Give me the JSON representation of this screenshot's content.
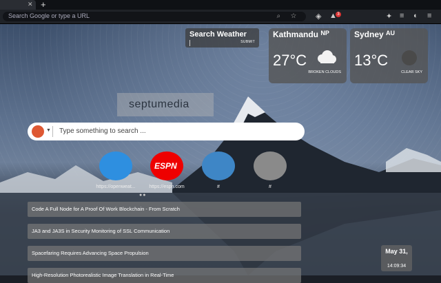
{
  "browser": {
    "address_placeholder": "Search Google or type a URL",
    "notification_count": "3"
  },
  "weather_search": {
    "title": "Search Weather",
    "submit": "SUBMIT"
  },
  "weather_cards": [
    {
      "city": "Kathmandu",
      "country": "NP",
      "temp": "27°C",
      "condition": "BROKEN CLOUDS",
      "icon": "cloud-icon"
    },
    {
      "city": "Sydney",
      "country": "AU",
      "temp": "13°C",
      "condition": "CLEAR SKY",
      "icon": "moon-icon"
    }
  ],
  "logo": {
    "text": "septumedia"
  },
  "search": {
    "placeholder": "Type something to search ..."
  },
  "tiles": [
    {
      "label": "https://openweat...",
      "icon": "weather-icon"
    },
    {
      "label": "https://espn.com",
      "icon": "espn-icon",
      "logo_text": "ESPN"
    },
    {
      "label": "#",
      "icon": "book-icon"
    },
    {
      "label": "#",
      "icon": "folders-icon"
    }
  ],
  "news": [
    "Code A Full Node for A Proof Of Work Blockchain - From Scratch",
    "JA3 and JA3S in Security Monitoring of SSL Communication",
    "Spacefaring Requires Advancing Space Propulsion",
    "High-Resolution Photorealistic Image Translation in Real-Time"
  ],
  "clock": {
    "date": "May 31,",
    "time": "14:09:34"
  }
}
